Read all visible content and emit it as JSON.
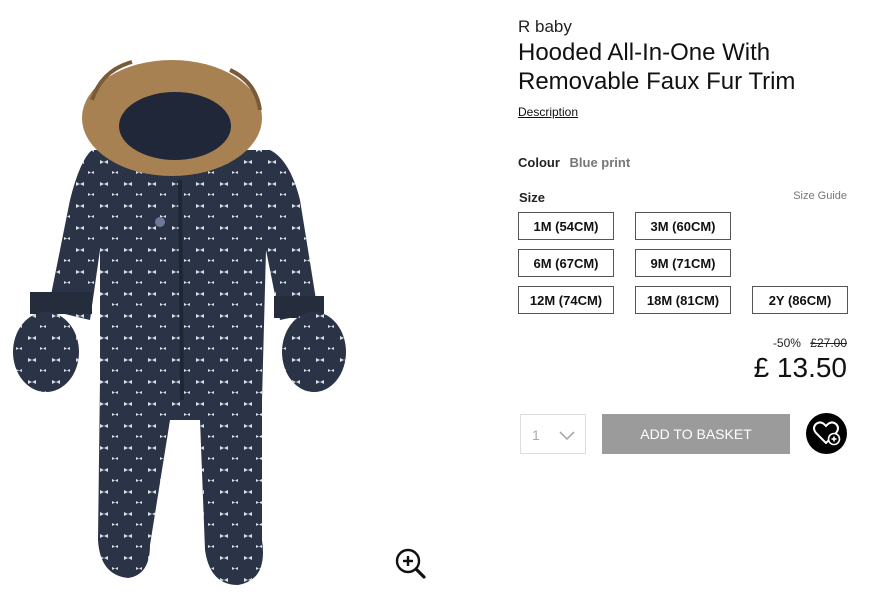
{
  "product": {
    "brand": "R baby",
    "title": "Hooded All-In-One With Removable Faux Fur Trim",
    "description_link": "Description",
    "colour_label": "Colour",
    "colour_value": "Blue print",
    "size_label": "Size",
    "size_guide": "Size Guide",
    "sizes": [
      "1M (54CM)",
      "3M (60CM)",
      "6M (67CM)",
      "9M (71CM)",
      "12M (74CM)",
      "18M (81CM)",
      "2Y (86CM)"
    ],
    "discount": "-50%",
    "original_price": "£27.00",
    "price": "£ 13.50",
    "quantity": "1",
    "add_to_basket": "ADD TO BASKET"
  },
  "colors": {
    "accent": "#9b9b9b",
    "snowsuit": "#2b3447",
    "fur": "#a88152"
  },
  "icons": {
    "zoom": "zoom-in-icon",
    "wishlist": "heart-plus-icon",
    "quantity_dropdown": "chevron-down-icon"
  }
}
